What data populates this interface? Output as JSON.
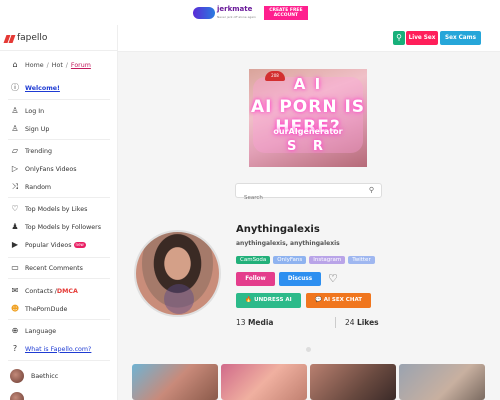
{
  "ad": {
    "brand": "jerkmate",
    "tagline": "Never jerk off alone again",
    "cta": "CREATE FREE ACCOUNT"
  },
  "logo": {
    "text": "fapello"
  },
  "breadcrumb": {
    "home": "Home",
    "hot": "Hot",
    "forum": "Forum",
    "sep": "/"
  },
  "sidebar": {
    "welcome": "Welcome!",
    "login": "Log In",
    "signup": "Sign Up",
    "trending": "Trending",
    "of_videos": "OnlyFans Videos",
    "random": "Random",
    "top_likes": "Top Models by Likes",
    "top_followers": "Top Models by Followers",
    "popular_videos": "Popular Videos",
    "new_badge": "new",
    "recent_comments": "Recent Comments",
    "contacts": "Contacts / ",
    "dmca": "DMCA",
    "porndude": "ThePornDude",
    "language": "Language",
    "what_is": "What is Fapello.com?",
    "user1": "Baethicc",
    "user2": "..."
  },
  "header": {
    "live_sex": "Live Sex",
    "sex_cams": "Sex Cams"
  },
  "cover": {
    "hat": "208",
    "line1": "A I",
    "line2": "AI  PORN IS HERE?",
    "line3": "ourAIgenerator",
    "line4": "S  R"
  },
  "search": {
    "placeholder": "Search"
  },
  "profile": {
    "name": "Anythingalexis",
    "handles": "anythingalexis, anythingalexis",
    "tags": [
      "CamSoda",
      "OnlyFans",
      "Instagram",
      "Twitter"
    ],
    "follow": "Follow",
    "discuss": "Discuss",
    "undress_ai": "UNDRESS AI",
    "ai_sex_chat": "AI SEX CHAT",
    "media_count": "13",
    "media_label": "Media",
    "likes_count": "24",
    "likes_label": "Likes"
  },
  "colors": {
    "follow": "#e43d8c",
    "discuss": "#2d8ff0",
    "undress": "#2cba8a",
    "aichat": "#f0761e",
    "live": "#ff1f5a",
    "sexcams": "#26a6d9"
  },
  "icons": [
    "home-icon",
    "info-icon",
    "user-icon",
    "user-plus-icon",
    "trending-icon",
    "video-icon",
    "shuffle-icon",
    "heart-icon",
    "followers-icon",
    "video-icon",
    "comments-icon",
    "mail-icon",
    "porndude-icon",
    "language-icon",
    "help-icon",
    "search-icon"
  ]
}
